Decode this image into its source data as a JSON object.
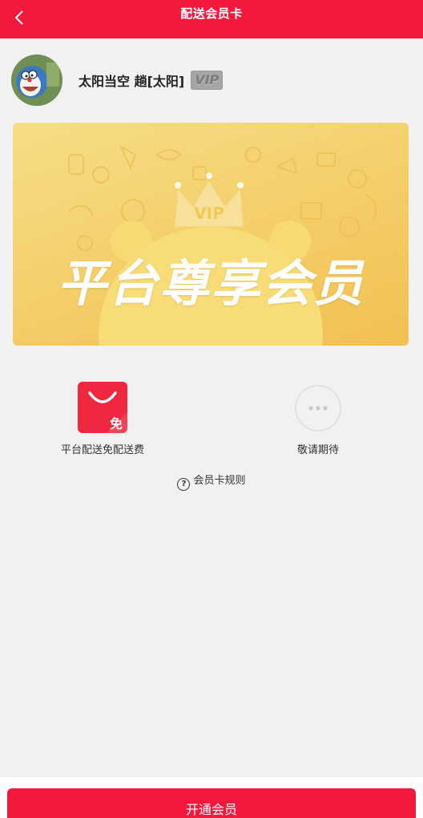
{
  "header": {
    "title": "配送会员卡",
    "back_icon": "chevron-left-icon",
    "background": "#f5183d"
  },
  "user": {
    "name": "太阳当空 趟[太阳]",
    "vip_badge": "VIP"
  },
  "card": {
    "crown_label": "VIP",
    "title": "平台尊享会员"
  },
  "benefits": [
    {
      "label": "平台配送免配送费",
      "icon": "shopping-bag-free-icon",
      "icon_text": "免"
    },
    {
      "label": "敬请期待",
      "icon": "more-dots-icon"
    }
  ],
  "rules_link": "会员卡规则",
  "open_button": "开通会员",
  "accent_color": "#f5183d"
}
